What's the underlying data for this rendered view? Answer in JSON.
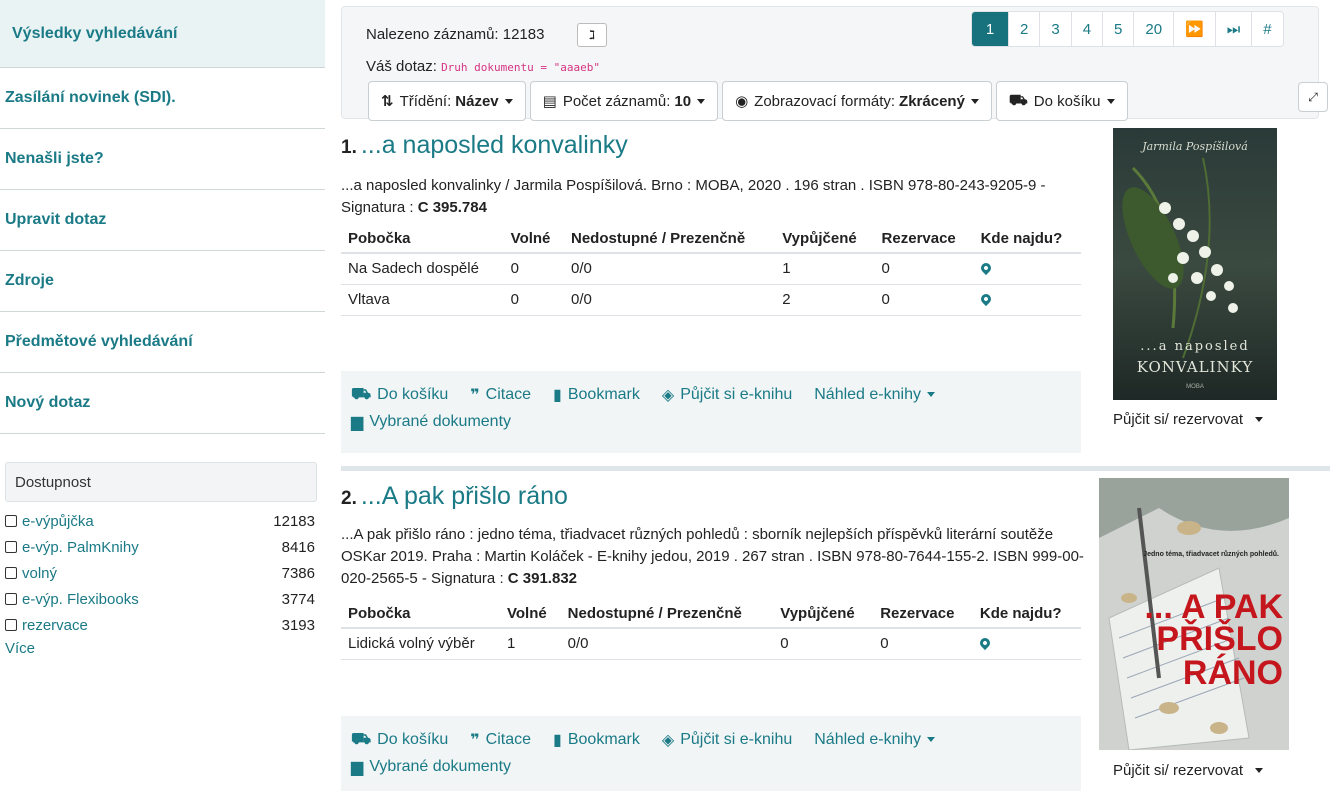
{
  "sidebar": {
    "items": [
      {
        "label": "Výsledky vyhledávání"
      },
      {
        "label": "Zasílání novinek (SDI)."
      },
      {
        "label": "Nenašli jste?"
      },
      {
        "label": "Upravit dotaz"
      },
      {
        "label": "Zdroje"
      },
      {
        "label": "Předmětové vyhledávání"
      },
      {
        "label": "Nový dotaz"
      }
    ],
    "facet": {
      "title": "Dostupnost",
      "rows": [
        {
          "label": "e-výpůjčka",
          "count": "12183"
        },
        {
          "label": "e-výp. PalmKnihy",
          "count": "8416"
        },
        {
          "label": "volný",
          "count": "7386"
        },
        {
          "label": "e-výp. Flexibooks",
          "count": "3774"
        },
        {
          "label": "rezervace",
          "count": "3193"
        }
      ],
      "more": "Více"
    }
  },
  "topbar": {
    "found_label": "Nalezeno záznamů: 12183",
    "query_label": "Váš dotaz:",
    "query_value": "Druh dokumentu = \"aaaeb\"",
    "pager": [
      "1",
      "2",
      "3",
      "4",
      "5",
      "20",
      "⏩",
      "⏭",
      "#"
    ],
    "sort_label": "Třídění:",
    "sort_value": "Název",
    "count_label": "Počet záznamů:",
    "count_value": "10",
    "format_label": "Zobrazovací formáty:",
    "format_value": "Zkrácený",
    "cart_label": "Do košíku"
  },
  "holdings_headers": [
    "Pobočka",
    "Volné",
    "Nedostupné / Prezenčně",
    "Vypůjčené",
    "Rezervace",
    "Kde najdu?"
  ],
  "records": [
    {
      "num": "1.",
      "title": "...a naposled konvalinky",
      "desc": "...a naposled konvalinky / Jarmila Pospíšilová.    Brno : MOBA, 2020 . 196 stran . ISBN 978-80-243-9205-9 - Signatura : ",
      "signature": "C 395.784",
      "holdings": [
        [
          "Na Sadech dospělé",
          "0",
          "0/0",
          "1",
          "0"
        ],
        [
          "Vltava",
          "0",
          "0/0",
          "2",
          "0"
        ]
      ],
      "cover_author": "Jarmila Pospíšilová",
      "cover_title1": "...a naposled",
      "cover_title2": "KONVALINKY",
      "cover_publisher": "MOBA"
    },
    {
      "num": "2.",
      "title": "...A pak přišlo ráno",
      "desc": "...A pak přišlo ráno : jedno téma, třiadvacet různých pohledů : sborník nejlepších příspěvků literární soutěže OSKar 2019.    Praha : Martin Koláček - E-knihy jedou, 2019 . 267 stran . ISBN 978-80-7644-155-2. ISBN 999-00-020-2565-5 - Signatura : ",
      "signature": "C 391.832",
      "holdings": [
        [
          "Lidická volný výběr",
          "1",
          "0/0",
          "0",
          "0"
        ]
      ],
      "cover_tagline": "Jedno téma, třiadvacet různých pohledů.",
      "cover_title1": "... A PAK",
      "cover_title2": "PŘIŠLO",
      "cover_title3": "RÁNO"
    }
  ],
  "actions": {
    "cart": "Do košíku",
    "cite": "Citace",
    "bookmark": "Bookmark",
    "borrow_ebook": "Půjčit si e-knihu",
    "preview": "Náhled e-knihy",
    "selected": "Vybrané dokumenty",
    "reserve": "Půjčit si/ rezervovat"
  }
}
